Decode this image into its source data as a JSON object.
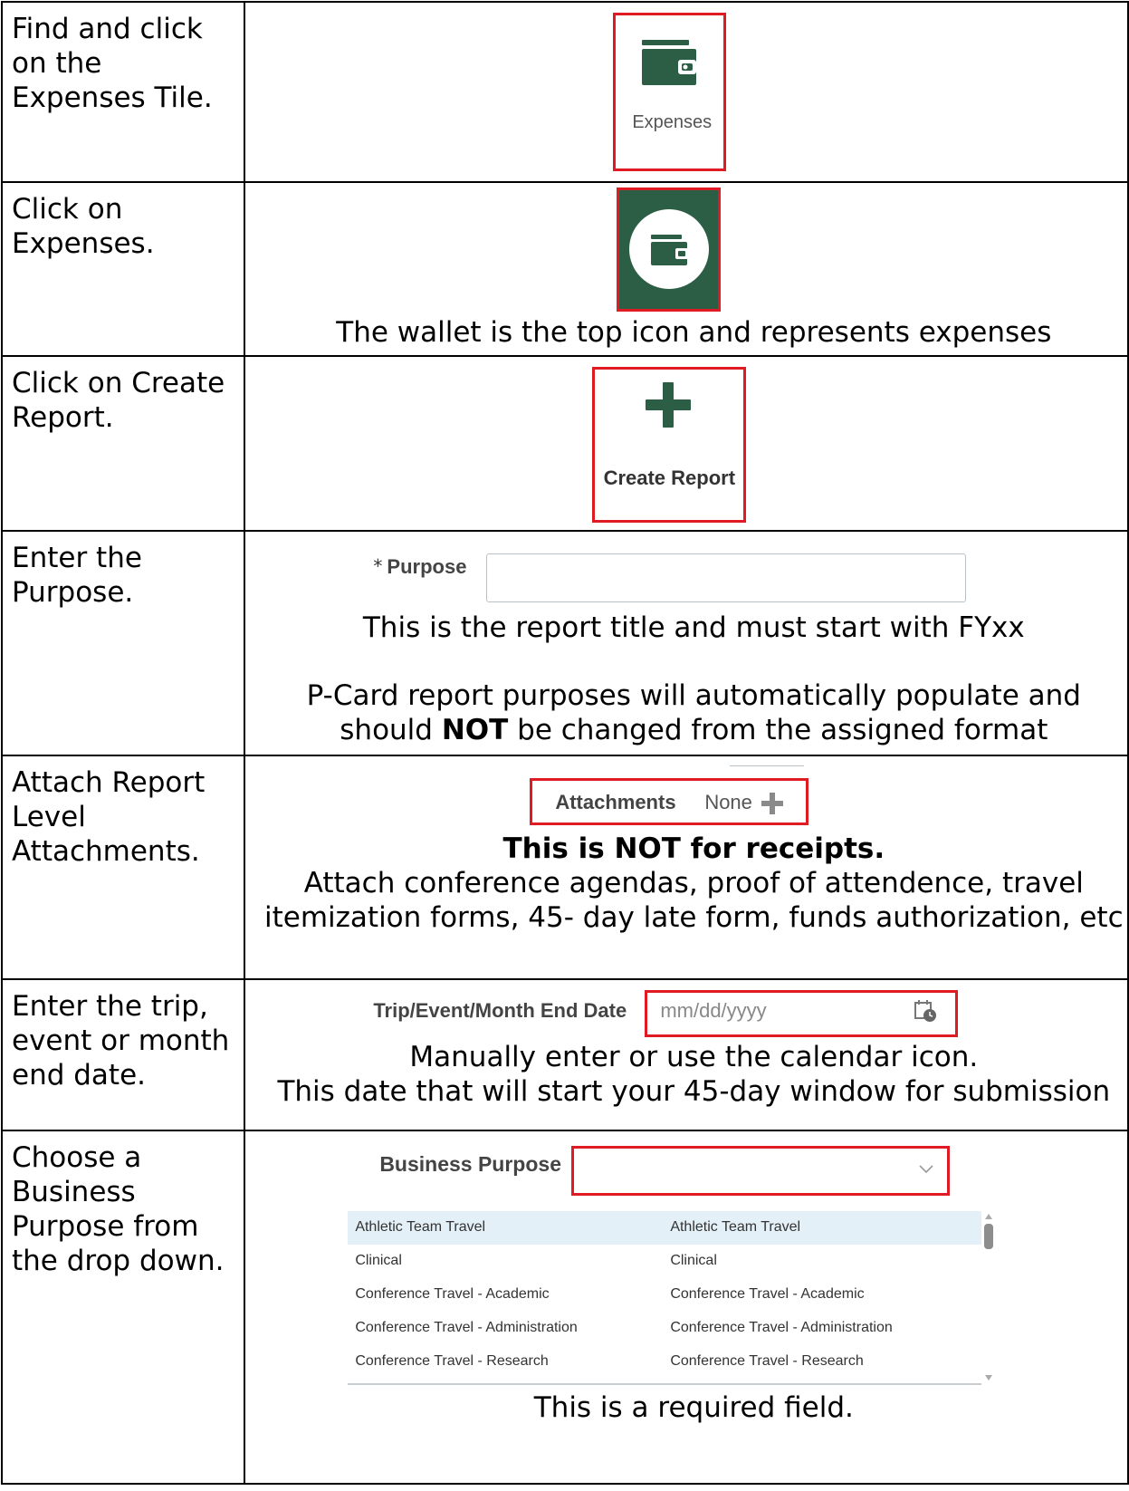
{
  "steps": [
    {
      "instruction": "Find and click on the Expenses Tile.",
      "tile_label": "Expenses"
    },
    {
      "instruction": "Click on Expenses.",
      "caption": "The wallet is the top icon and represents expenses"
    },
    {
      "instruction": "Click on Create Report.",
      "button_label": "Create Report"
    },
    {
      "instruction": "Enter the Purpose.",
      "required_marker": "*",
      "field_label": "Purpose",
      "caption_1": "This is the report title and must start with FYxx",
      "caption_2a": "P-Card report purposes will automatically populate and",
      "caption_2b_pre": "should ",
      "caption_2b_bold": "NOT",
      "caption_2b_post": " be changed from the assigned format"
    },
    {
      "instruction": "Attach Report Level Attachments.",
      "field_label": "Attachments",
      "field_value": "None",
      "caption_bold": "This is NOT for receipts.",
      "caption": "Attach conference agendas, proof of attendence, travel itemization forms, 45- day late form, funds authorization, etc"
    },
    {
      "instruction": "Enter the trip, event or month end date.",
      "field_label": "Trip/Event/Month End Date",
      "placeholder": "mm/dd/yyyy",
      "caption_1": "Manually enter or use the calendar icon.",
      "caption_2": "This date that will start your 45-day window for submission"
    },
    {
      "instruction": "Choose a Business Purpose from the drop down.",
      "field_label": "Business Purpose",
      "options": [
        [
          "Athletic Team Travel",
          "Athletic Team Travel"
        ],
        [
          "Clinical",
          "Clinical"
        ],
        [
          "Conference Travel - Academic",
          "Conference Travel - Academic"
        ],
        [
          "Conference Travel - Administration",
          "Conference Travel - Administration"
        ],
        [
          "Conference Travel - Research",
          "Conference Travel - Research"
        ]
      ],
      "caption": "This is a required field."
    }
  ],
  "colors": {
    "brand_green": "#2b5e44",
    "highlight_red": "#e01b24"
  }
}
